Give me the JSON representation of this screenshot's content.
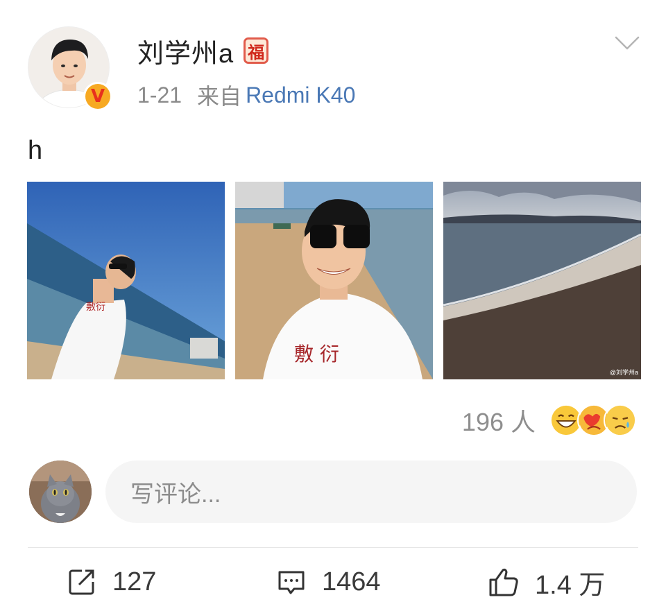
{
  "header": {
    "username": "刘学州a",
    "badge": "福",
    "date": "1-21",
    "from_label": "来自",
    "device": "Redmi K40"
  },
  "post": {
    "text": "h"
  },
  "photos": [
    {
      "name": "photo-boy-sky-sea"
    },
    {
      "name": "photo-selfie-beach"
    },
    {
      "name": "photo-shoreline"
    }
  ],
  "watermark": "@刘学州a",
  "reactions": {
    "count": "196 人",
    "emojis": [
      "grin-icon",
      "love-icon",
      "sad-icon"
    ]
  },
  "comment": {
    "placeholder": "写评论..."
  },
  "actions": {
    "repost_count": "127",
    "comment_count": "1464",
    "like_count": "1.4 万"
  },
  "colors": {
    "link": "#4a78b5",
    "muted": "#8a8a8a",
    "badge_red": "#d0281c",
    "verified_gold": "#f7a922"
  }
}
